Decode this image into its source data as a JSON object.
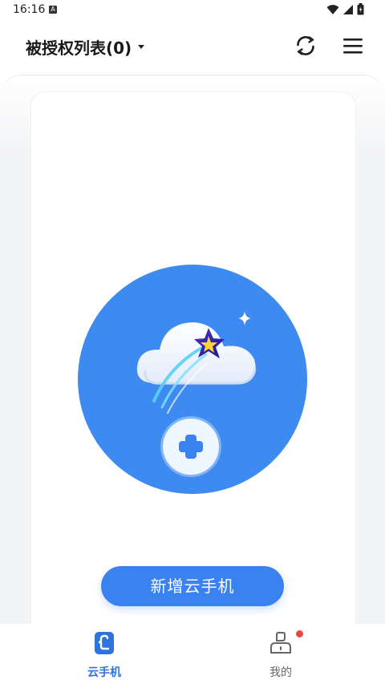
{
  "status_bar": {
    "time": "16:16",
    "notif_letter": "A"
  },
  "header": {
    "title": "被授权列表(0)"
  },
  "main": {
    "add_phone_label": "新增云手机"
  },
  "bottom_nav": {
    "items": [
      {
        "label": "云手机",
        "icon": "cloud-phone-icon",
        "active": true
      },
      {
        "label": "我的",
        "icon": "user-profile-icon",
        "active": false,
        "badge": true
      }
    ]
  },
  "colors": {
    "accent": "#3a82ef",
    "circle": "#3d8af0",
    "badge": "#ef4545"
  }
}
